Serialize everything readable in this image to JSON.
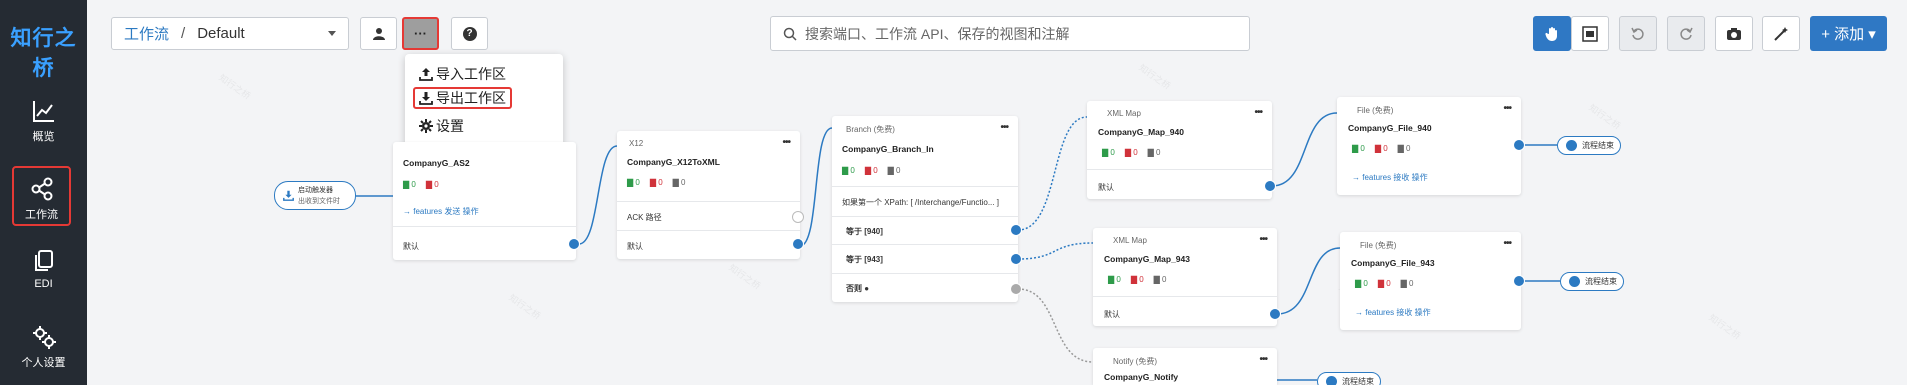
{
  "brand": {
    "logo_text": "知行之桥",
    "accent": "#2f78c4"
  },
  "sidebar": {
    "items": [
      {
        "label": "概览",
        "icon": "chart-line-icon",
        "active": false
      },
      {
        "label": "工作流",
        "icon": "share-nodes-icon",
        "active": true
      },
      {
        "label": "EDI",
        "icon": "copy-icon",
        "active": false
      },
      {
        "label": "个人设置",
        "icon": "gears-icon",
        "active": false
      }
    ]
  },
  "breadcrumb": {
    "root": "工作流",
    "separator": "/",
    "current": "Default"
  },
  "toolbar": {
    "more_label": "···",
    "help_label": "?"
  },
  "search": {
    "placeholder": "搜索端口、工作流 API、保存的视图和注解"
  },
  "actions": {
    "add_label": "+ 添加 ▾"
  },
  "dropdown": {
    "items": [
      {
        "label": "导入工作区",
        "icon": "upload-icon",
        "highlighted": false
      },
      {
        "label": "导出工作区",
        "icon": "download-icon",
        "highlighted": true
      },
      {
        "label": "设置",
        "icon": "gear-icon",
        "highlighted": false
      }
    ]
  },
  "flow": {
    "trigger": {
      "title": "启动触发器",
      "subtitle": "出收到文件时"
    },
    "nodes": [
      {
        "id": "as2",
        "type": "",
        "name": "CompanyG_AS2",
        "stats": [
          "0",
          "0"
        ],
        "link": "→ features 发送 操作",
        "out": "默认"
      },
      {
        "id": "x12",
        "type": "X12",
        "name": "CompanyG_X12ToXML",
        "stats": [
          "0",
          "0",
          "0"
        ],
        "ack": "ACK 路径",
        "out": "默认"
      },
      {
        "id": "branch",
        "type": "Branch (免费)",
        "name": "CompanyG_Branch_In",
        "stats": [
          "0",
          "0",
          "0"
        ],
        "cond": "如果第一个 XPath: [ /Interchange/Functio... ]",
        "rows": [
          "等于 [940]",
          "等于 [943]",
          "否则 ●"
        ]
      },
      {
        "id": "map940",
        "type": "XML Map",
        "name": "CompanyG_Map_940",
        "stats": [
          "0",
          "0",
          "0"
        ],
        "out": "默认"
      },
      {
        "id": "map943",
        "type": "XML Map",
        "name": "CompanyG_Map_943",
        "stats": [
          "0",
          "0",
          "0"
        ],
        "out": "默认"
      },
      {
        "id": "file940",
        "type": "File (免费)",
        "name": "CompanyG_File_940",
        "stats": [
          "0",
          "0",
          "0"
        ],
        "link": "→ features 接收 操作"
      },
      {
        "id": "file943",
        "type": "File (免费)",
        "name": "CompanyG_File_943",
        "stats": [
          "0",
          "0",
          "0"
        ],
        "link": "→ features 接收 操作"
      },
      {
        "id": "notify",
        "type": "Notify (免费)",
        "name": "CompanyG_Notify"
      }
    ],
    "end_label": "流程结束"
  }
}
